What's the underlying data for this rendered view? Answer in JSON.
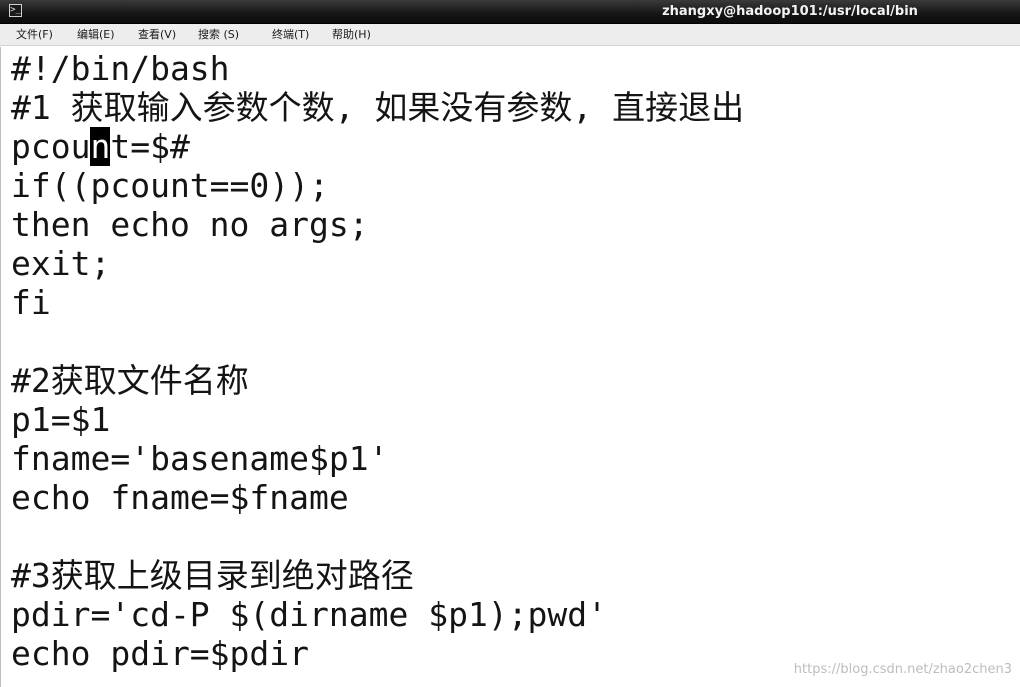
{
  "window": {
    "title": "zhangxy@hadoop101:/usr/local/bin",
    "icon": "terminal-icon"
  },
  "menu": {
    "items": [
      "文件(F)",
      "编辑(E)",
      "查看(V)",
      "搜索 (S)",
      "终端(T)",
      "帮助(H)"
    ]
  },
  "terminal": {
    "lines": [
      "#!/bin/bash",
      "#1 获取输入参数个数, 如果没有参数, 直接退出",
      "pcount=$#",
      "if((pcount==0));",
      "then echo no args;",
      "exit;",
      "fi",
      "",
      "#2获取文件名称",
      "p1=$1",
      "fname='basename$p1'",
      "echo fname=$fname",
      "",
      "#3获取上级目录到绝对路径",
      "pdir='cd-P $(dirname $p1);pwd'",
      "echo pdir=$pdir"
    ],
    "cursor": {
      "before": "pcou",
      "char": "n",
      "after": "t=$#"
    }
  },
  "watermark": "https://blog.csdn.net/zhao2chen3"
}
